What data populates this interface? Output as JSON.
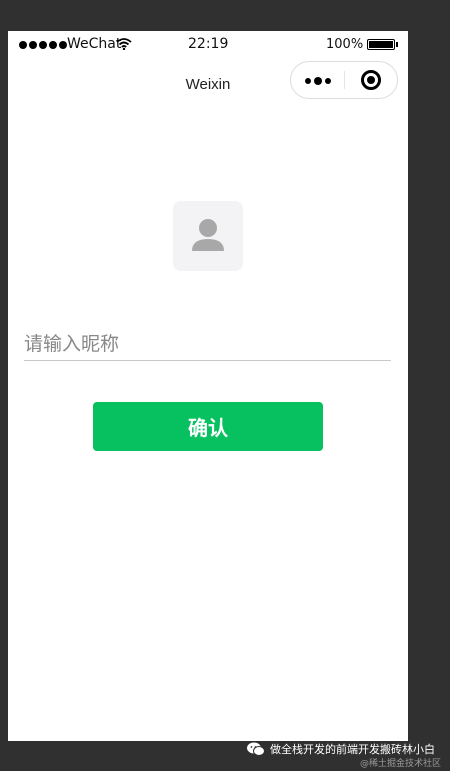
{
  "status_bar": {
    "carrier": "WeChat",
    "time": "22:19",
    "battery": "100%"
  },
  "nav": {
    "title": "Weixin"
  },
  "form": {
    "nickname_placeholder": "请输入昵称",
    "nickname_value": "",
    "confirm_label": "确认"
  },
  "watermark": {
    "main": "做全栈开发的前端开发搬砖林小白",
    "sub": "@稀土掘金技术社区"
  },
  "colors": {
    "accent": "#07c160",
    "background": "#303030"
  },
  "icons": {
    "avatar": "default-avatar-icon",
    "more": "more-dots-icon",
    "close": "close-miniprogram-icon"
  }
}
